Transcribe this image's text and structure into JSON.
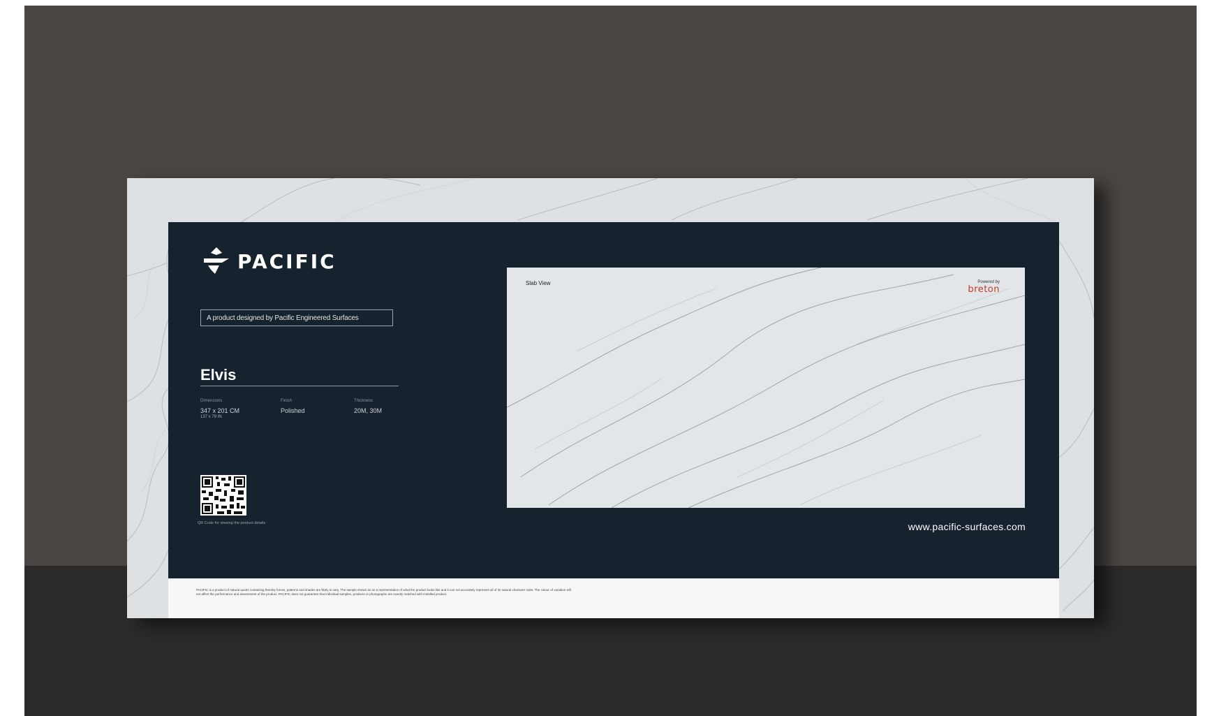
{
  "brand": {
    "logo_text": "PACIFIC",
    "logo_icon": "pacific-logo-icon",
    "tagline": "A product designed by Pacific Engineered Surfaces"
  },
  "product": {
    "name": "Elvis",
    "specs": [
      {
        "label": "Dimensions",
        "value": "347 x 201 CM",
        "sub": "137 x 79 IN"
      },
      {
        "label": "Finish",
        "value": "Polished",
        "sub": ""
      },
      {
        "label": "Thickness",
        "value": "20M, 30M",
        "sub": ""
      }
    ]
  },
  "qr": {
    "icon": "qr-code-icon",
    "caption": "QR Code for viewing the product details"
  },
  "preview": {
    "label": "Slab View",
    "powered_label": "Powered by",
    "powered_brand": "breton"
  },
  "footer": {
    "website": "www.pacific-surfaces.com",
    "disclaimer": "PACIFIC is a product of natural quartz containing thereby forces, patterns and shades are likely to vary. The sample shown as an a representation of what the product looks like and it can not accurately represent all of its natural character rules. The colour of variation will not affect the performance and assessment of the product. PACIFIC does not guarantee that individual samples, products or photographs are exactly matched with installed product."
  },
  "colors": {
    "backdrop": "#4a4643",
    "floor": "#2c2b2a",
    "panel": "#16222e",
    "marble": "#dde1e3",
    "accent_brand": "#c0392b"
  }
}
